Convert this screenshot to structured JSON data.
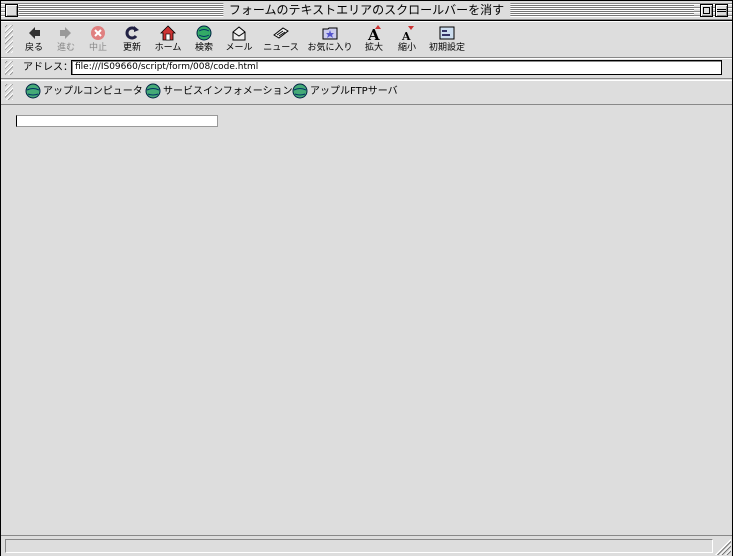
{
  "window": {
    "title": "フォームのテキストエリアのスクロールバーを消す"
  },
  "toolbar": {
    "buttons": [
      {
        "label": "戻る",
        "icon": "back-arrow-icon",
        "enabled": true
      },
      {
        "label": "進む",
        "icon": "forward-arrow-icon",
        "enabled": false
      },
      {
        "label": "中止",
        "icon": "stop-icon",
        "enabled": false
      },
      {
        "label": "更新",
        "icon": "refresh-icon",
        "enabled": true
      },
      {
        "label": "ホーム",
        "icon": "home-icon",
        "enabled": true
      },
      {
        "label": "検索",
        "icon": "search-globe-icon",
        "enabled": true
      },
      {
        "label": "メール",
        "icon": "mail-icon",
        "enabled": true
      },
      {
        "label": "ニュース",
        "icon": "news-icon",
        "enabled": true
      },
      {
        "label": "お気に入り",
        "icon": "favorites-icon",
        "enabled": true
      },
      {
        "label": "拡大",
        "icon": "text-larger-icon",
        "enabled": true
      },
      {
        "label": "縮小",
        "icon": "text-smaller-icon",
        "enabled": true
      },
      {
        "label": "初期設定",
        "icon": "preferences-icon",
        "enabled": true
      }
    ]
  },
  "address": {
    "label": "アドレス：",
    "value": "file:///IS09660/script/form/008/code.html"
  },
  "links": [
    {
      "label": "アップルコンピュータ",
      "icon": "globe-icon"
    },
    {
      "label": "サービスインフォメーション",
      "icon": "globe-icon"
    },
    {
      "label": "アップルFTPサーバ",
      "icon": "globe-icon"
    }
  ],
  "colors": {
    "chrome": "#dddddd",
    "stop_red": "#cc3333",
    "link_globe": "#3366aa"
  }
}
